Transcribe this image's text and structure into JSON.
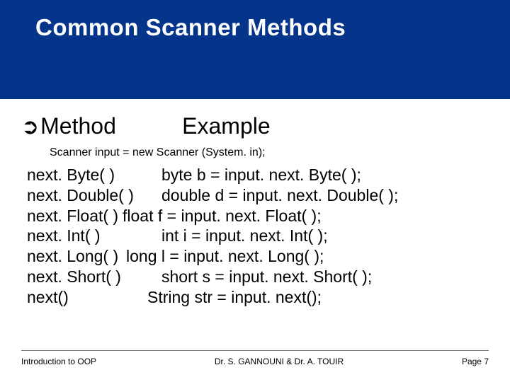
{
  "title": "Common Scanner Methods",
  "headers": {
    "method": "Method",
    "example": "Example"
  },
  "declaration": "Scanner input = new Scanner (System. in);",
  "rows": [
    {
      "method": "next. Byte( )",
      "example": "byte b = input. next. Byte( );"
    },
    {
      "method": "next. Double( )",
      "example": "double d = input. next. Double( );"
    },
    {
      "method": "next. Float( )",
      "example": "float f = input. next. Float( );"
    },
    {
      "method": "next. Int( )",
      "example": "int i = input. next. Int( );"
    },
    {
      "method": "next. Long( )",
      "example": "long l = input. next. Long( );"
    },
    {
      "method": "next. Short( )",
      "example": "short s = input. next. Short( );"
    },
    {
      "method": "next()",
      "example": "String str = input. next();"
    }
  ],
  "footer": {
    "left": "Introduction to OOP",
    "center": "Dr. S. GANNOUNI & Dr.  A. TOUIR",
    "right": "Page 7"
  }
}
